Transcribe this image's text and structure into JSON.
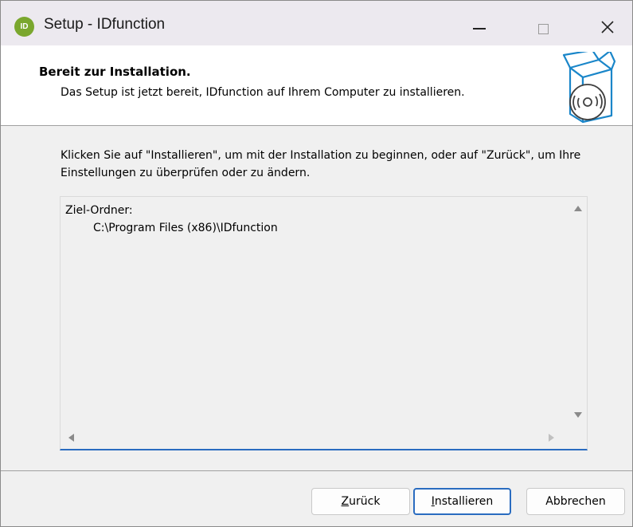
{
  "window": {
    "title": "Setup - IDfunction",
    "app_icon_text": "ID"
  },
  "header": {
    "title": "Bereit zur Installation.",
    "subtitle": "Das Setup ist jetzt bereit, IDfunction auf Ihrem Computer zu installieren."
  },
  "main": {
    "info_text": "Klicken Sie auf \"Installieren\", um mit der Installation zu beginnen, oder auf \"Zurück\", um Ihre Einstellungen zu überprüfen oder zu ändern.",
    "memo": {
      "label": "Ziel-Ordner:",
      "value": "C:\\Program Files (x86)\\IDfunction"
    }
  },
  "buttons": {
    "back": {
      "accel": "Z",
      "rest": "urück"
    },
    "install": {
      "accel": "I",
      "rest": "nstallieren"
    },
    "cancel": "Abbrechen"
  },
  "colors": {
    "accent": "#2a6cc0",
    "icon_green": "#7aa72e",
    "header_bg": "#ffffff",
    "dialog_bg": "#f0f0f0",
    "icon_stroke": "#1a86c9"
  },
  "icons": {
    "app": "idfunction-logo-icon",
    "header": "software-box-icon",
    "minimize": "minimize-icon",
    "maximize": "maximize-icon",
    "close": "close-icon"
  }
}
